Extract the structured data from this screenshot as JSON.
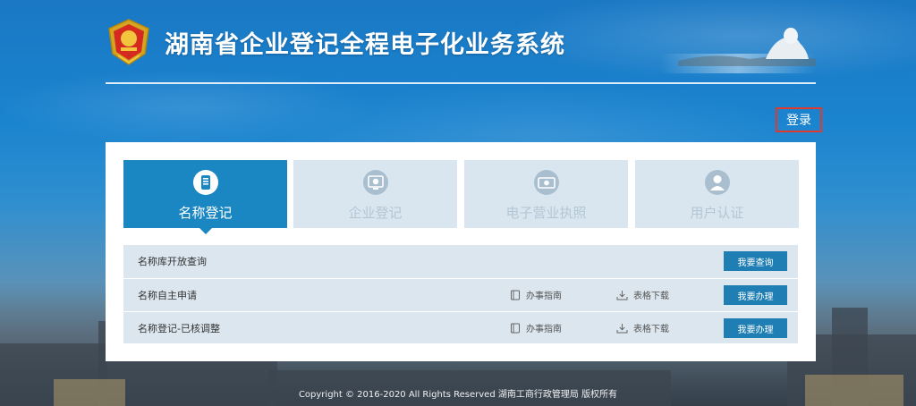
{
  "header": {
    "title": "湖南省企业登记全程电子化业务系统"
  },
  "auth": {
    "login_label": "登录"
  },
  "tabs": [
    {
      "label": "名称登记",
      "icon": "document-icon",
      "active": true
    },
    {
      "label": "企业登记",
      "icon": "enterprise-monitor-icon",
      "active": false
    },
    {
      "label": "电子营业执照",
      "icon": "license-card-icon",
      "active": false
    },
    {
      "label": "用户认证",
      "icon": "user-icon",
      "active": false
    }
  ],
  "rows": [
    {
      "name": "名称库开放查询",
      "guide": "",
      "download": "",
      "action": "我要查询"
    },
    {
      "name": "名称自主申请",
      "guide": "办事指南",
      "download": "表格下载",
      "action": "我要办理"
    },
    {
      "name": "名称登记-已核调整",
      "guide": "办事指南",
      "download": "表格下载",
      "action": "我要办理"
    }
  ],
  "footer": {
    "copyright": "Copyright © 2016-2020 All Rights Reserved 湖南工商行政管理局 版权所有"
  },
  "colors": {
    "accent": "#1a87c2",
    "button": "#1f7fb4",
    "login_border": "#e03a2f",
    "row_bg": "#dbe6ee",
    "tab_inactive": "#d9e6ef"
  }
}
